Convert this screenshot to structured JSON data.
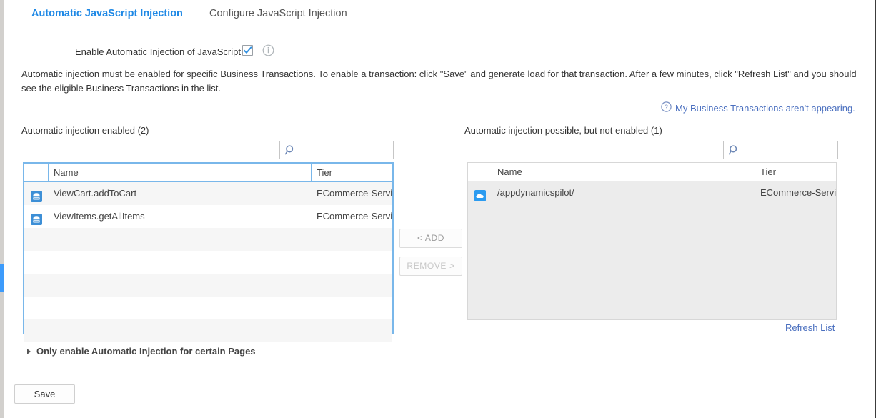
{
  "tabs": [
    {
      "label": "Automatic JavaScript Injection",
      "active": true
    },
    {
      "label": "Configure JavaScript Injection",
      "active": false
    }
  ],
  "enable_row": {
    "label": "Enable Automatic Injection of JavaScript",
    "checked": true,
    "info_icon": "info-circle-icon"
  },
  "description": "Automatic injection must be enabled for specific Business Transactions. To enable a transaction: click \"Save\" and generate load for that transaction. After a few minutes, click \"Refresh List\" and you should see the eligible Business Transactions in the list.",
  "help_link": {
    "icon": "question-circle-icon",
    "text": "My Business Transactions aren't appearing."
  },
  "left_panel": {
    "title": "Automatic injection enabled (2)",
    "search": {
      "value": "",
      "placeholder": "",
      "icon": "search-icon"
    },
    "columns": [
      "",
      "Name",
      "Tier"
    ],
    "rows": [
      {
        "icon": "business-transaction-icon",
        "name": "ViewCart.addToCart",
        "tier": "ECommerce-Service"
      },
      {
        "icon": "business-transaction-icon",
        "name": "ViewItems.getAllItems",
        "tier": "ECommerce-Service"
      }
    ],
    "empty_rows": 5
  },
  "right_panel": {
    "title": "Automatic injection possible, but not enabled (1)",
    "search": {
      "value": "",
      "placeholder": "",
      "icon": "search-icon"
    },
    "columns": [
      "",
      "Name",
      "Tier"
    ],
    "rows": [
      {
        "icon": "cloud-icon",
        "name": "/appdynamicspilot/",
        "tier": "ECommerce-Service"
      }
    ],
    "refresh_link": "Refresh List"
  },
  "transfer_buttons": {
    "add": "< ADD",
    "remove": "REMOVE >"
  },
  "accordion": {
    "arrow_icon": "triangle-right-icon",
    "label": "Only enable Automatic Injection for certain Pages"
  },
  "save_button": "Save",
  "colors": {
    "accent_blue": "#1e88e5",
    "link_blue": "#4a6fbf",
    "table_border_active": "#79b7ea",
    "scrollbar_thumb": "#3d9bfb",
    "row_icon_blue": "#3d8fd6"
  }
}
